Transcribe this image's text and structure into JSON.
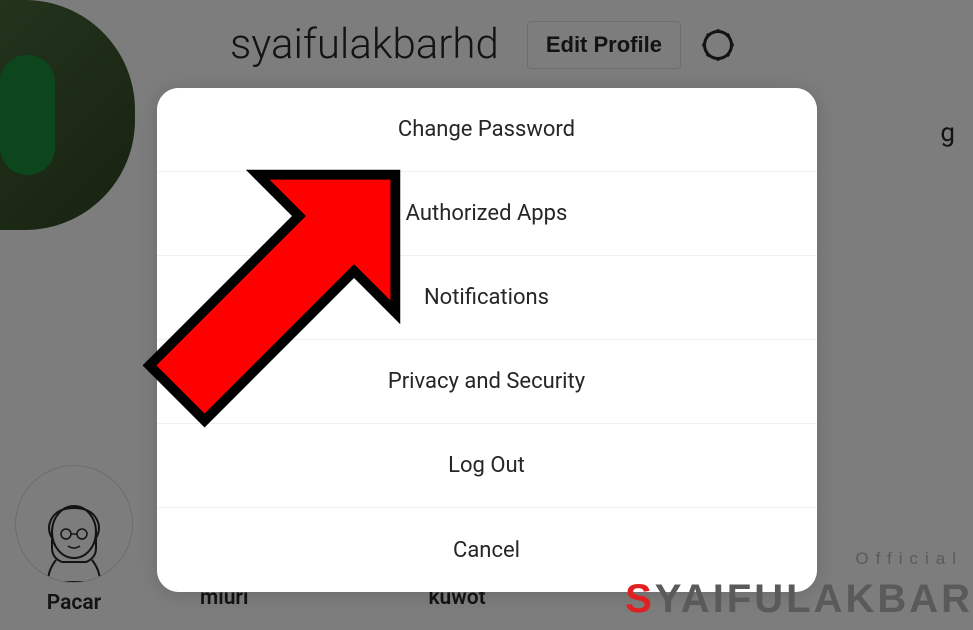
{
  "profile": {
    "username": "syaifulakbarhd",
    "edit_button": "Edit Profile"
  },
  "modal": {
    "items": [
      "Change Password",
      "Authorized Apps",
      "Notifications",
      "Privacy and Security",
      "Log Out",
      "Cancel"
    ]
  },
  "highlights": [
    {
      "label": "Pacar"
    }
  ],
  "bottom_labels": [
    "miuri",
    "kuwot"
  ],
  "watermark": {
    "official": "Official",
    "brand_s": "S",
    "brand_rest": "YAIFULAKBAR"
  },
  "bg_text": {
    "g": "g"
  }
}
